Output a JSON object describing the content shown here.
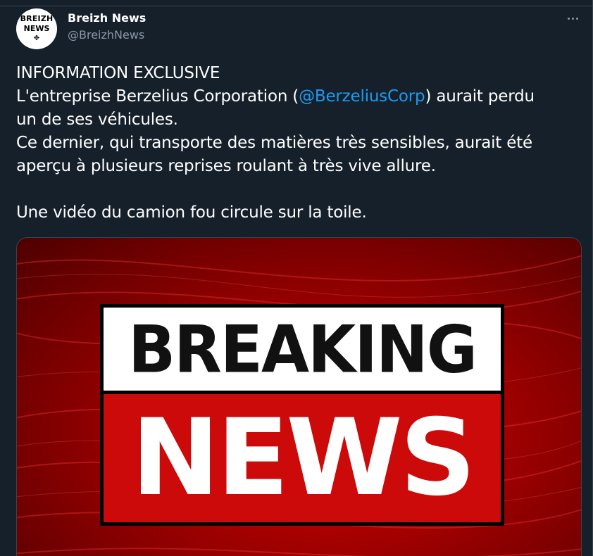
{
  "tweet": {
    "author": {
      "display_name": "Breizh News",
      "handle": "@BreizhNews",
      "avatar_line1": "BREIZH",
      "avatar_line2": "NEWS"
    },
    "more_icon": "more-dots-icon",
    "lines": [
      {
        "text": "INFORMATION EXCLUSIVE"
      },
      {
        "before": "L'entreprise Berzelius Corporation (",
        "mention": "@BerzeliusCorp",
        "after": ") aurait perdu"
      },
      {
        "text": "un de ses véhicules."
      },
      {
        "text": "Ce dernier, qui transporte des matières très sensibles, aurait été"
      },
      {
        "text": "aperçu à plusieurs reprises roulant à très vive allure."
      },
      {
        "text": "Une vidéo du camion fou circule sur la toile."
      }
    ],
    "media": {
      "headline_top": "BREAKING",
      "headline_bottom": "NEWS"
    }
  },
  "colors": {
    "background": "#15202b",
    "text": "#ffffff",
    "secondary": "#8b98a5",
    "mention": "#1d9bf0",
    "breaking_red": "#cc0a0a"
  }
}
